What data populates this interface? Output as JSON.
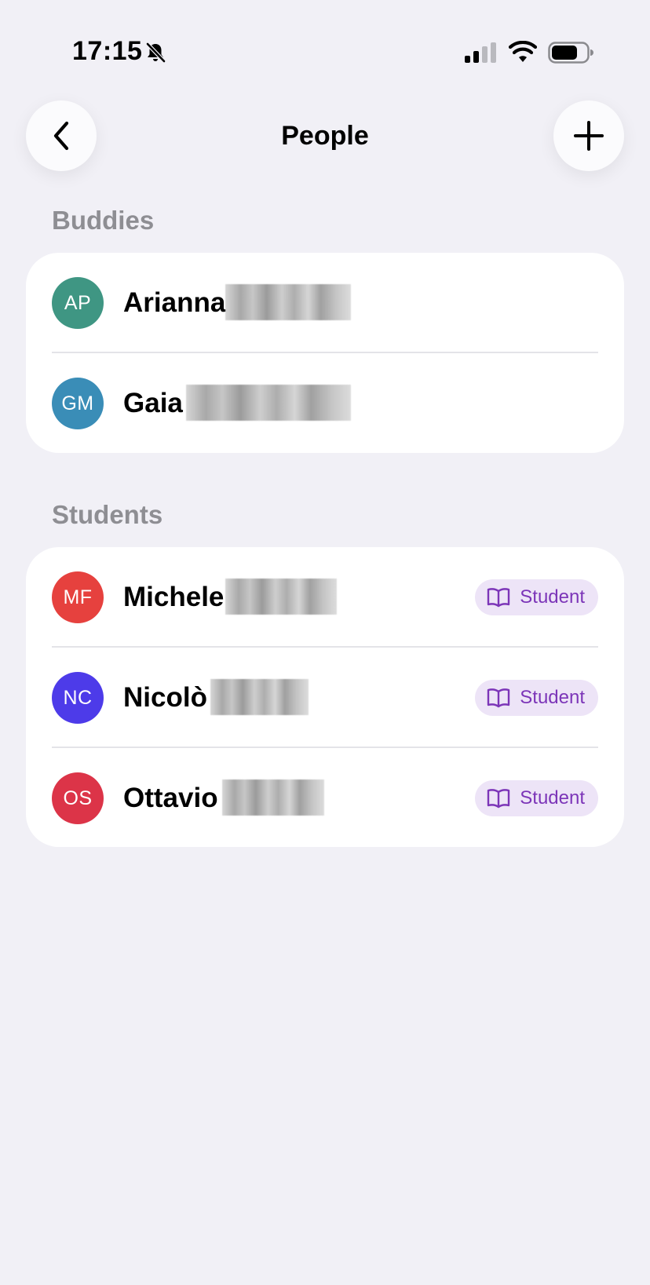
{
  "status_bar": {
    "time": "17:15"
  },
  "nav": {
    "title": "People"
  },
  "sections": {
    "buddies": {
      "header": "Buddies",
      "people": [
        {
          "initials": "AP",
          "name": "Arianna",
          "color": "#3f9683"
        },
        {
          "initials": "GM",
          "name": "Gaia",
          "color": "#3a8db7"
        }
      ]
    },
    "students": {
      "header": "Students",
      "badge_label": "Student",
      "people": [
        {
          "initials": "MF",
          "name": "Michele",
          "color": "#e6413e"
        },
        {
          "initials": "NC",
          "name": "Nicolò",
          "color": "#4d3be9"
        },
        {
          "initials": "OS",
          "name": "Ottavio",
          "color": "#dc3448"
        }
      ]
    }
  },
  "colors": {
    "background": "#f1f0f6",
    "badge_background": "#ede4f7",
    "badge_text": "#7c35b8",
    "section_header": "#8e8e93"
  }
}
